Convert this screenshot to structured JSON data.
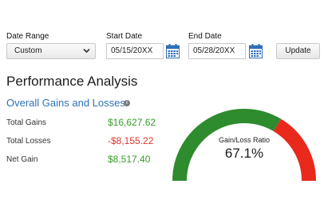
{
  "controls": {
    "date_range_label": "Date Range",
    "date_range_value": "Custom",
    "start_date_label": "Start Date",
    "start_date_value": "05/15/20XX",
    "end_date_label": "End Date",
    "end_date_value": "05/28/20XX",
    "update_label": "Update"
  },
  "page": {
    "title": "Performance Analysis",
    "section_title": "Overall Gains and Losses",
    "info_glyph": "i"
  },
  "summary": {
    "total_gains_label": "Total Gains",
    "total_gains_value": "$16,627.62",
    "total_losses_label": "Total Losses",
    "total_losses_value": "-$8,155.22",
    "net_gain_label": "Net Gain",
    "net_gain_value": "$8,517.40"
  },
  "gauge": {
    "label": "Gain/Loss Ratio",
    "value": "67.1%",
    "fraction": 0.671,
    "gain_color": "#2e8b2e",
    "loss_color": "#e8291c"
  },
  "colors": {
    "gain": "#3a9a2c",
    "loss": "#e0352b",
    "link": "#2c72b8",
    "calendar": "#2f6fb7"
  },
  "icons": {
    "chevron": "chevron-down-icon",
    "calendar": "calendar-icon",
    "info": "info-icon"
  }
}
